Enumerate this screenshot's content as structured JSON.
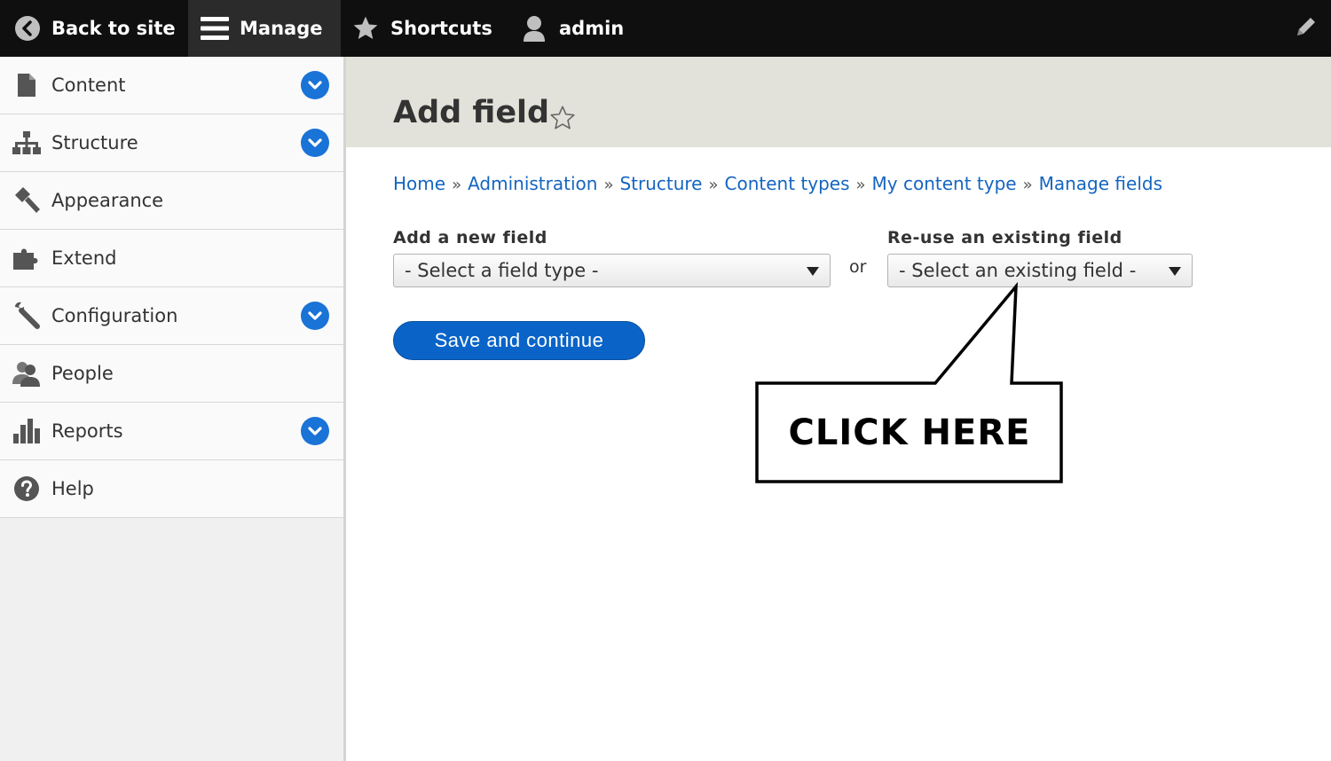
{
  "toolbar": {
    "back_label": "Back to site",
    "manage_label": "Manage",
    "shortcuts_label": "Shortcuts",
    "user_label": "admin"
  },
  "sidebar": {
    "items": [
      {
        "label": "Content",
        "icon": "file-icon",
        "expandable": true
      },
      {
        "label": "Structure",
        "icon": "sitemap-icon",
        "expandable": true
      },
      {
        "label": "Appearance",
        "icon": "paintbrush-icon",
        "expandable": false
      },
      {
        "label": "Extend",
        "icon": "puzzle-icon",
        "expandable": false
      },
      {
        "label": "Configuration",
        "icon": "wrench-icon",
        "expandable": true
      },
      {
        "label": "People",
        "icon": "people-icon",
        "expandable": false
      },
      {
        "label": "Reports",
        "icon": "bar-chart-icon",
        "expandable": true
      },
      {
        "label": "Help",
        "icon": "help-icon",
        "expandable": false
      }
    ]
  },
  "main": {
    "title": "Add field",
    "breadcrumb": [
      "Home",
      "Administration",
      "Structure",
      "Content types",
      "My content type",
      "Manage fields"
    ],
    "breadcrumb_separator": "»",
    "add_new_label": "Add a new field",
    "add_new_selected": "- Select a field type -",
    "or_text": "or",
    "reuse_label": "Re-use an existing field",
    "reuse_selected": "- Select an existing field -",
    "save_button": "Save and continue"
  },
  "callout": {
    "text": "CLICK HERE"
  },
  "colors": {
    "toolbar_bg": "#0f0f0f",
    "manage_bg": "#2b2b2b",
    "header_bg": "#e2e2da",
    "link": "#1565c0",
    "primary_button": "#0a64c8",
    "toggle": "#1a73d6"
  }
}
